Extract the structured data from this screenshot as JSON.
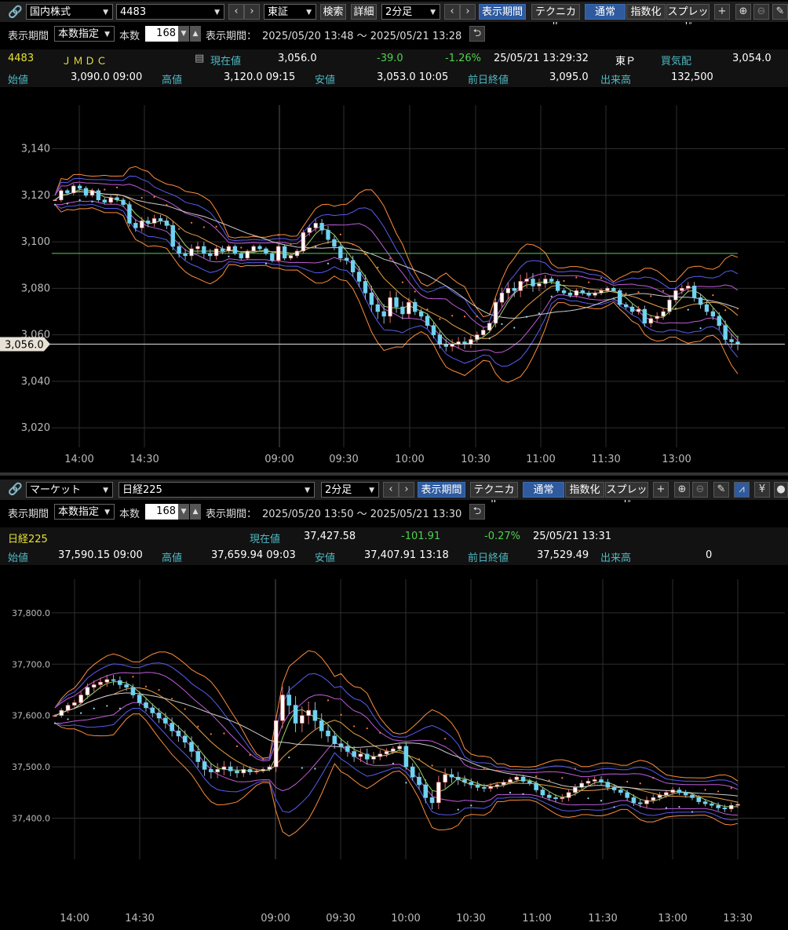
{
  "top": {
    "toolbar": {
      "market_select": "国内株式",
      "code_select": "4483",
      "exchange_select": "東証",
      "search_label": "検索",
      "detail_label": "詳細",
      "interval_select": "2分足",
      "period_label": "表示期間",
      "technical_label": "テクニカル",
      "normal_label": "通常",
      "index_label": "指数化",
      "spread_label": "スプレッド",
      "plus_icon": "plus-icon",
      "zoom_in_icon": "zoom-in-icon",
      "zoom_out_icon": "zoom-out-icon",
      "pencil_icon": "pencil-icon"
    },
    "period_row": {
      "period_label": "表示期間",
      "period_mode": "本数指定",
      "count_label": "本数",
      "count_value": "168",
      "range_label": "表示期間：",
      "range_value": "2025/05/20 13:48 ～ 2025/05/21 13:28"
    },
    "quote1": {
      "code": "4483",
      "name": "ＪＭＤＣ",
      "current_label": "現在値",
      "current_value": "3,056.0",
      "change": "-39.0",
      "change_pct": "-1.26%",
      "datetime": "25/05/21  13:29:32",
      "market": "東Ｐ",
      "bid_label": "買気配",
      "bid_value": "3,054.0"
    },
    "quote2": {
      "open_label": "始値",
      "open_value": "3,090.0  09:00",
      "high_label": "高値",
      "high_value": "3,120.0  09:15",
      "low_label": "安値",
      "low_value": "3,053.0  10:05",
      "prev_close_label": "前日終値",
      "prev_close_value": "3,095.0",
      "volume_label": "出来高",
      "volume_value": "132,500"
    }
  },
  "bottom": {
    "toolbar": {
      "market_select": "マーケット",
      "index_select": "日経225",
      "interval_select": "2分足",
      "period_label": "表示期間",
      "technical_label": "テクニカル",
      "normal_label": "通常",
      "index_label": "指数化",
      "spread_label": "スプレッド"
    },
    "period_row": {
      "period_label": "表示期間",
      "period_mode": "本数指定",
      "count_label": "本数",
      "count_value": "168",
      "range_label": "表示期間：",
      "range_value": "2025/05/20 13:50 ～ 2025/05/21 13:30"
    },
    "quote1": {
      "name": "日経225",
      "current_label": "現在値",
      "current_value": "37,427.58",
      "change": "-101.91",
      "change_pct": "-0.27%",
      "datetime": "25/05/21  13:31"
    },
    "quote2": {
      "open_label": "始値",
      "open_value": "37,590.15  09:00",
      "high_label": "高値",
      "high_value": "37,659.94  09:03",
      "low_label": "安値",
      "low_value": "37,407.91  13:18",
      "prev_close_label": "前日終値",
      "prev_close_value": "37,529.49",
      "volume_label": "出来高",
      "volume_value": "0"
    }
  },
  "colors": {
    "background": "#000000",
    "toolbar": "#1e1e1e",
    "accent_blue": "#2f5b9e",
    "up_candle": "#ffffff",
    "down_candle": "#6fd3f0",
    "bollinger_outer": "#ff8c3a",
    "bollinger_mid": "#5b5bf0",
    "bollinger_inner": "#c05cd8",
    "sar": "#ff7a3a",
    "prev_close_line": "#4fd14f"
  },
  "chart_data": [
    {
      "type": "candlestick",
      "title": "4483 ＪＭＤＣ",
      "y_ticks": [
        "3,140",
        "3,120",
        "3,100",
        "3,080",
        "3,060",
        "3,040",
        "3,020"
      ],
      "y_tick_values": [
        3140,
        3120,
        3100,
        3080,
        3060,
        3040,
        3020
      ],
      "ylim": [
        3015,
        3152
      ],
      "x_ticks": [
        "14:00",
        "14:30",
        "09:00",
        "09:30",
        "10:00",
        "10:30",
        "11:00",
        "11:30",
        "13:00"
      ],
      "current_price_label": "3,056.0",
      "current_price": 3056.0,
      "prev_close": 3095.0,
      "closes": [
        3118,
        3122,
        3121,
        3124,
        3123,
        3120,
        3122,
        3118,
        3117,
        3119,
        3118,
        3116,
        3108,
        3106,
        3109,
        3108,
        3110,
        3109,
        3107,
        3098,
        3095,
        3094,
        3097,
        3098,
        3095,
        3094,
        3097,
        3096,
        3098,
        3095,
        3093,
        3096,
        3098,
        3097,
        3095,
        3092,
        3098,
        3093,
        3094,
        3096,
        3104,
        3106,
        3108,
        3105,
        3101,
        3098,
        3093,
        3092,
        3087,
        3083,
        3078,
        3073,
        3070,
        3068,
        3076,
        3072,
        3069,
        3074,
        3070,
        3068,
        3064,
        3060,
        3056,
        3055,
        3056,
        3057,
        3056,
        3058,
        3060,
        3062,
        3065,
        3074,
        3078,
        3080,
        3079,
        3083,
        3084,
        3081,
        3082,
        3084,
        3083,
        3079,
        3078,
        3077,
        3079,
        3078,
        3077,
        3078,
        3079,
        3080,
        3079,
        3073,
        3072,
        3070,
        3071,
        3065,
        3067,
        3068,
        3070,
        3075,
        3079,
        3080,
        3081,
        3076,
        3073,
        3070,
        3068,
        3064,
        3058,
        3057,
        3056
      ]
    },
    {
      "type": "candlestick",
      "title": "日経225",
      "y_ticks": [
        "37,800.0",
        "37,700.0",
        "37,600.0",
        "37,500.0",
        "37,400.0"
      ],
      "y_tick_values": [
        37800,
        37700,
        37600,
        37500,
        37400
      ],
      "ylim": [
        37335,
        37835
      ],
      "x_ticks": [
        "14:00",
        "14:30",
        "09:00",
        "09:30",
        "10:00",
        "10:30",
        "11:00",
        "11:30",
        "13:00",
        "13:30"
      ],
      "closes": [
        37600,
        37610,
        37620,
        37625,
        37640,
        37655,
        37660,
        37665,
        37670,
        37668,
        37660,
        37655,
        37640,
        37625,
        37615,
        37605,
        37595,
        37585,
        37570,
        37560,
        37548,
        37530,
        37510,
        37495,
        37490,
        37495,
        37500,
        37492,
        37488,
        37495,
        37490,
        37492,
        37495,
        37500,
        37590,
        37640,
        37620,
        37585,
        37600,
        37610,
        37590,
        37570,
        37560,
        37545,
        37540,
        37530,
        37520,
        37525,
        37515,
        37520,
        37525,
        37530,
        37535,
        37540,
        37500,
        37480,
        37465,
        37440,
        37430,
        37470,
        37485,
        37480,
        37475,
        37470,
        37465,
        37460,
        37458,
        37462,
        37465,
        37470,
        37475,
        37480,
        37472,
        37468,
        37455,
        37445,
        37440,
        37438,
        37440,
        37450,
        37460,
        37468,
        37472,
        37475,
        37470,
        37460,
        37455,
        37450,
        37440,
        37430,
        37428,
        37435,
        37440,
        37445,
        37450,
        37455,
        37450,
        37445,
        37440,
        37432,
        37428,
        37425,
        37420,
        37418,
        37425,
        37427
      ]
    }
  ]
}
